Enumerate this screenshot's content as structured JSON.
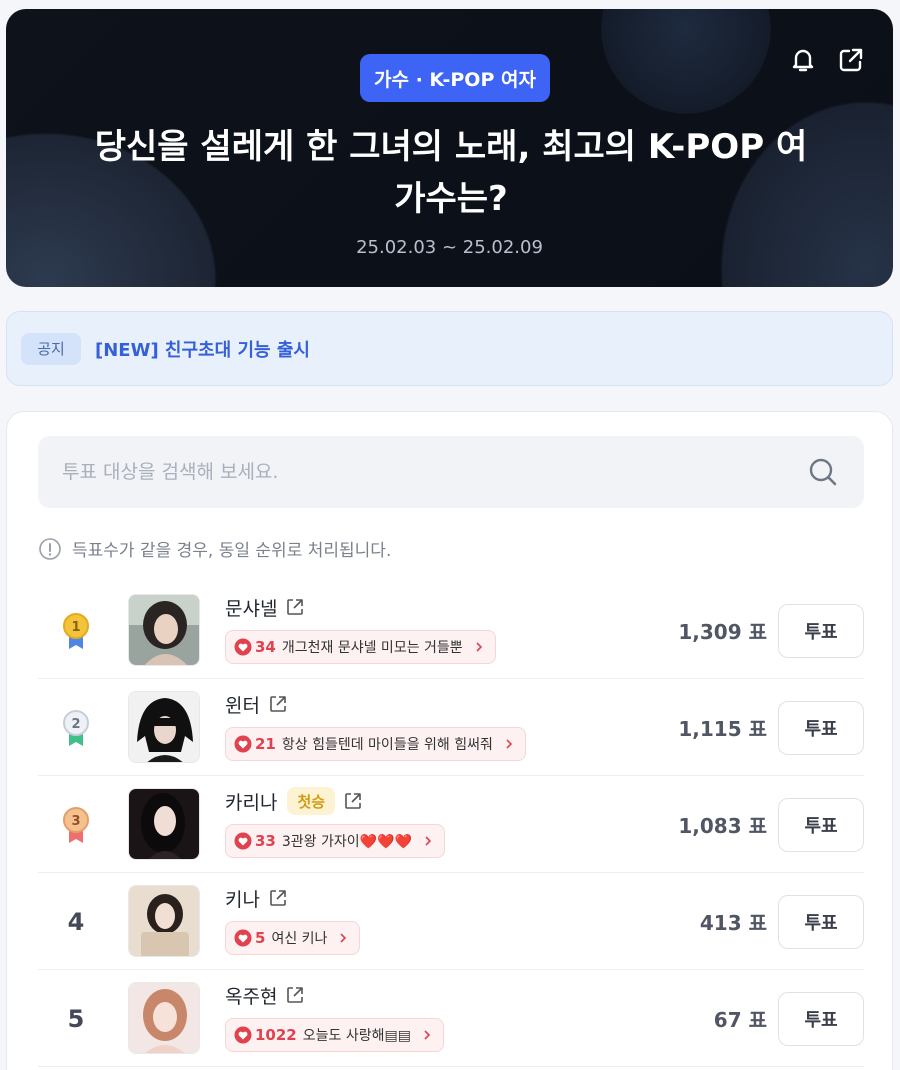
{
  "hero": {
    "category_badge": "가수 · K-POP 여자",
    "title": "당신을 설레게 한 그녀의 노래, 최고의 K-POP 여가수는?",
    "dates": "25.02.03 ~ 25.02.09"
  },
  "notice": {
    "tag": "공지",
    "text": "[NEW] 친구초대 기능 출시"
  },
  "search": {
    "placeholder": "투표 대상을 검색해 보세요."
  },
  "hint": "득표수가 같을 경우, 동일 순위로 처리됩니다.",
  "vote_label": "투표",
  "candidates": [
    {
      "rank": "1",
      "medal": "gold",
      "name": "문샤넬",
      "badge": "",
      "comment_count": "34",
      "comment": "개그천재 문샤넬 미모는 거들뿐",
      "votes": "1,309 표"
    },
    {
      "rank": "2",
      "medal": "silver",
      "name": "윈터",
      "badge": "",
      "comment_count": "21",
      "comment": "항상 힘들텐데 마이들을 위해 힘써줘",
      "votes": "1,115 표"
    },
    {
      "rank": "3",
      "medal": "bronze",
      "name": "카리나",
      "badge": "첫승",
      "comment_count": "33",
      "comment": "3관왕 가자이❤️❤️❤️",
      "votes": "1,083 표"
    },
    {
      "rank": "4",
      "medal": "",
      "name": "키나",
      "badge": "",
      "comment_count": "5",
      "comment": "여신 키나",
      "votes": "413 표"
    },
    {
      "rank": "5",
      "medal": "",
      "name": "옥주현",
      "badge": "",
      "comment_count": "1022",
      "comment": "오늘도 사랑해▤▤",
      "votes": "67 표"
    }
  ],
  "colors": {
    "accent": "#3d64f5",
    "heart": "#e0424e",
    "notice_text": "#3560d8"
  }
}
